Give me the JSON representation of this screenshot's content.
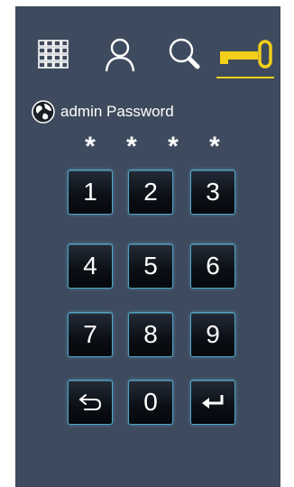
{
  "tabs": [
    {
      "id": "grid",
      "icon": "grid-icon"
    },
    {
      "id": "user",
      "icon": "user-icon"
    },
    {
      "id": "search",
      "icon": "search-icon"
    },
    {
      "id": "key",
      "icon": "key-icon",
      "active": true
    }
  ],
  "colors": {
    "panel": "#3e4a5d",
    "accent": "#f1cf1a",
    "key_border": "#4ea5c7"
  },
  "header": {
    "icon": "globe-icon",
    "title": "admin Password"
  },
  "password_mask": [
    "*",
    "*",
    "*",
    "*"
  ],
  "keypad": {
    "k1": "1",
    "k2": "2",
    "k3": "3",
    "k4": "4",
    "k5": "5",
    "k6": "6",
    "k7": "7",
    "k8": "8",
    "k9": "9",
    "k0": "0",
    "back_icon": "back-arrow-icon",
    "enter_icon": "enter-icon"
  }
}
